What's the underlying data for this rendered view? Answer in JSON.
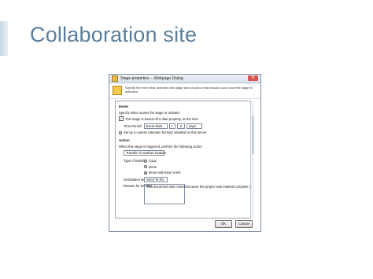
{
  "slide": {
    "title": "Collaboration site"
  },
  "dialog": {
    "title": "Stage properties -- Webpage Dialog",
    "close_glyph": "✕",
    "header_text": "Specify the event that activates this stage and an action that should occur once the stage is activated.",
    "event": {
      "heading": "Event",
      "intro": "Specify what causes the stage to activate:",
      "option_date_label": "This stage is based off a date property on the item",
      "time_period_label": "Time Period:",
      "date_field": "Event Date",
      "operator": "+",
      "offset": "0",
      "unit": "days",
      "option_custom_label": "Set by a custom retention formula installed on this server"
    },
    "action": {
      "heading": "Action",
      "intro": "When this stage is triggered, perform the following action:",
      "selected_action": "Transfer to another location",
      "type_label": "Type of transfer:",
      "transfer_types": [
        "Copy",
        "Move",
        "Move and leave a link"
      ],
      "destination_label": "Destination location:",
      "destination_value": "Send To RC",
      "reason_label": "Reason for transfer:",
      "reason_text": "This document was moved because the project was marked complete (event date column was populated)."
    },
    "buttons": {
      "ok": "OK",
      "cancel": "Cancel"
    }
  }
}
